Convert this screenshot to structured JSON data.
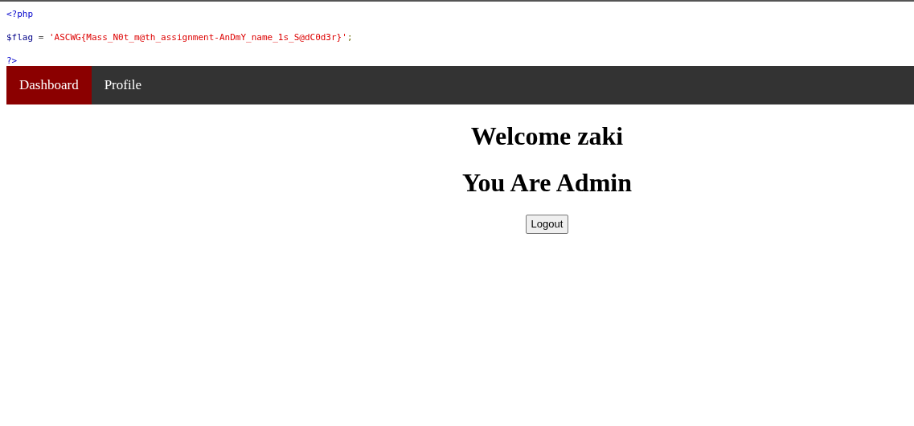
{
  "code_lines": [
    [
      {
        "kind": "tag",
        "text": "<?php"
      }
    ],
    [
      {
        "kind": "variable",
        "text": "$flag"
      },
      {
        "kind": "operator",
        "text": " = "
      },
      {
        "kind": "string",
        "text": "'ASCWG{Mass_N0t_m@th_assignment-AnDmY_name_1s_S@dC0d3r}'"
      },
      {
        "kind": "punct",
        "text": ";"
      }
    ],
    [
      {
        "kind": "tag",
        "text": "?>"
      }
    ]
  ],
  "nav": [
    {
      "label": "Dashboard",
      "selected": true
    },
    {
      "label": "Profile",
      "selected": false
    }
  ],
  "headings": [
    "Welcome zaki",
    "You Are Admin"
  ],
  "logout_button": "Logout"
}
